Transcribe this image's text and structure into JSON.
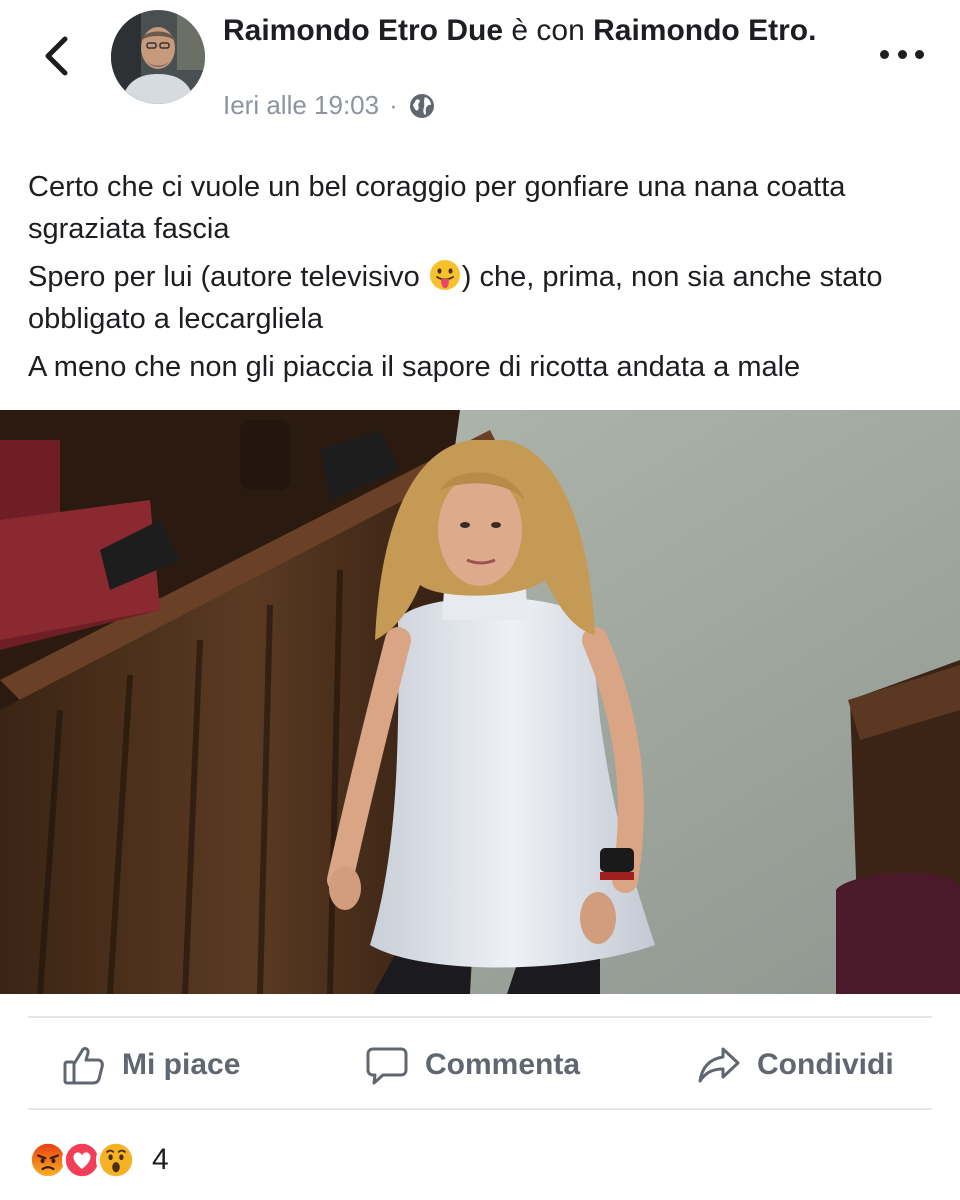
{
  "post": {
    "author_name": "Raimondo Etro Due",
    "with_word": "è con",
    "tagged_name": "Raimondo Etro.",
    "timestamp": "Ieri alle 19:03",
    "separator": "·",
    "privacy_icon": "globe-icon",
    "text_lines": [
      "Certo che ci vuole un bel coraggio per gonfiare una nana coatta sgraziata fascia",
      "Spero per lui (autore televisivo",
      ") che, prima, non sia anche stato obbligato a leccargliela",
      "A meno che non gli piaccia il sapore di ricotta andata a male"
    ],
    "inline_emoji": "tongue-out-emoji"
  },
  "actions": {
    "like_label": "Mi piace",
    "comment_label": "Commenta",
    "share_label": "Condividi"
  },
  "reactions": {
    "icons": [
      "angry-reaction-icon",
      "love-reaction-icon",
      "wow-reaction-icon"
    ],
    "count": "4"
  },
  "colors": {
    "text": "#1c1e21",
    "secondary": "#606770",
    "meta": "#8d949e",
    "love": "#f33e58",
    "angry": "#e9710f",
    "wow": "#f7b125"
  }
}
